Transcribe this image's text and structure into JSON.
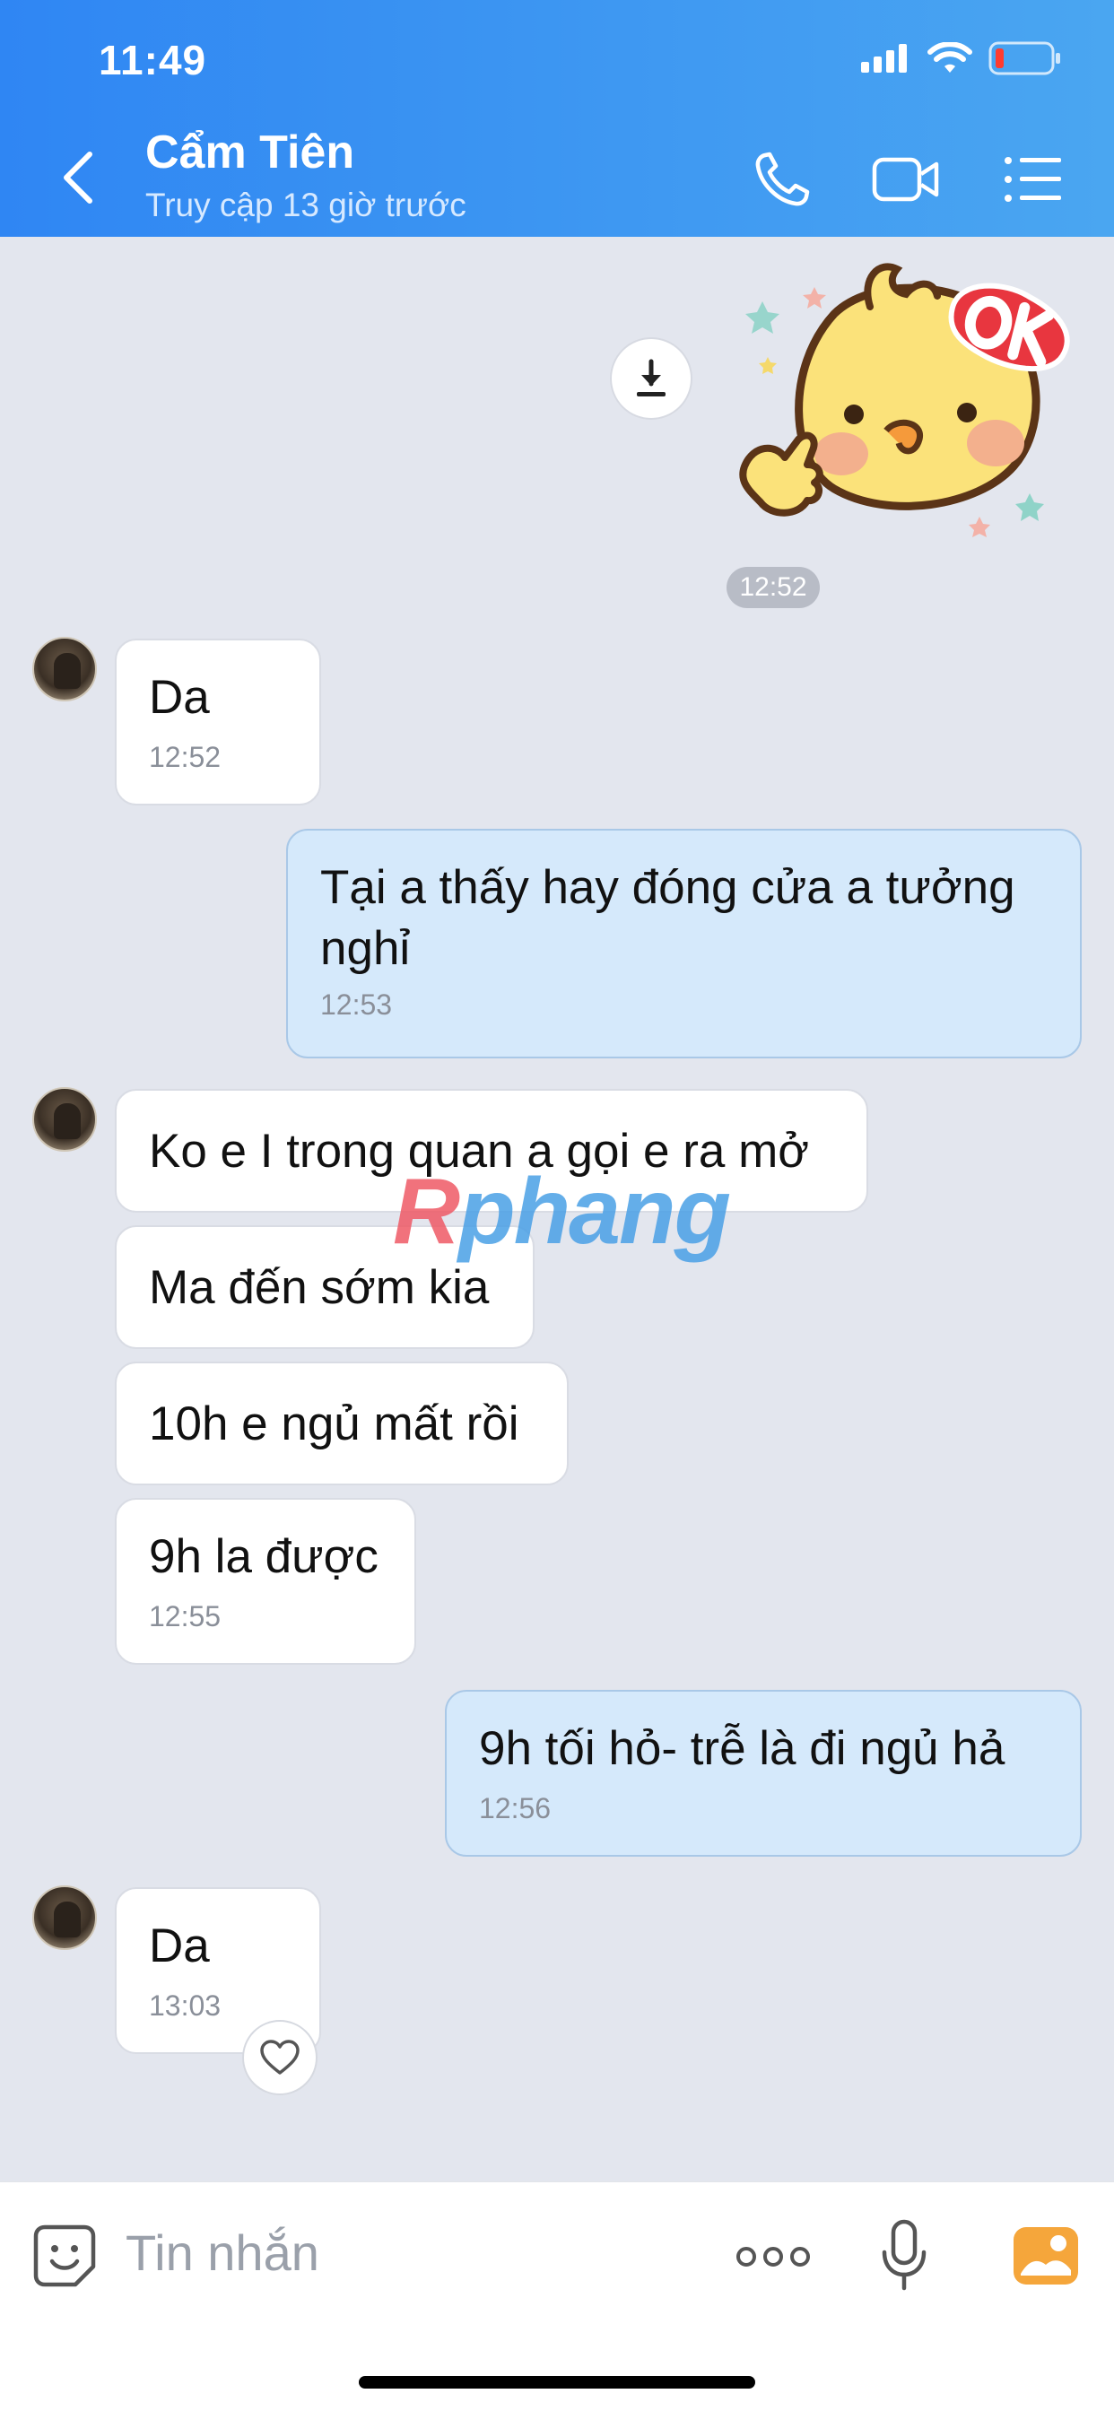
{
  "status_bar": {
    "time": "11:49"
  },
  "header": {
    "title": "Cẩm Tiên",
    "subtitle": "Truy cập 13 giờ trước"
  },
  "chat": {
    "sticker_time": "12:52",
    "messages": [
      {
        "text": "Da",
        "time": "12:52"
      },
      {
        "text": "Tại a thấy hay đóng cửa a tưởng\nnghỉ",
        "time": "12:53"
      },
      {
        "text": "Ko e I trong quan a gọi e ra mở"
      },
      {
        "text": "Ma đến sớm kia"
      },
      {
        "text": "10h e ngủ mất rồi"
      },
      {
        "text": "9h la được",
        "time": "12:55"
      },
      {
        "text": "9h tối hỏ- trễ là đi ngủ hả",
        "time": "12:56"
      },
      {
        "text": "Da",
        "time": "13:03"
      }
    ]
  },
  "watermark": {
    "part1": "R",
    "part2": "phang"
  },
  "input": {
    "placeholder": "Tin nhắn"
  },
  "colors": {
    "header_start": "#2f86f3",
    "header_end": "#4aa6f1",
    "outgoing_bubble": "#d5e9fb",
    "incoming_bubble": "#ffffff",
    "chat_bg": "#e3e6ee"
  },
  "icons": [
    "back-icon",
    "phone-icon",
    "video-icon",
    "menu-icon",
    "download-icon",
    "heart-icon",
    "emoji-icon",
    "more-icon",
    "mic-icon",
    "gallery-icon"
  ]
}
